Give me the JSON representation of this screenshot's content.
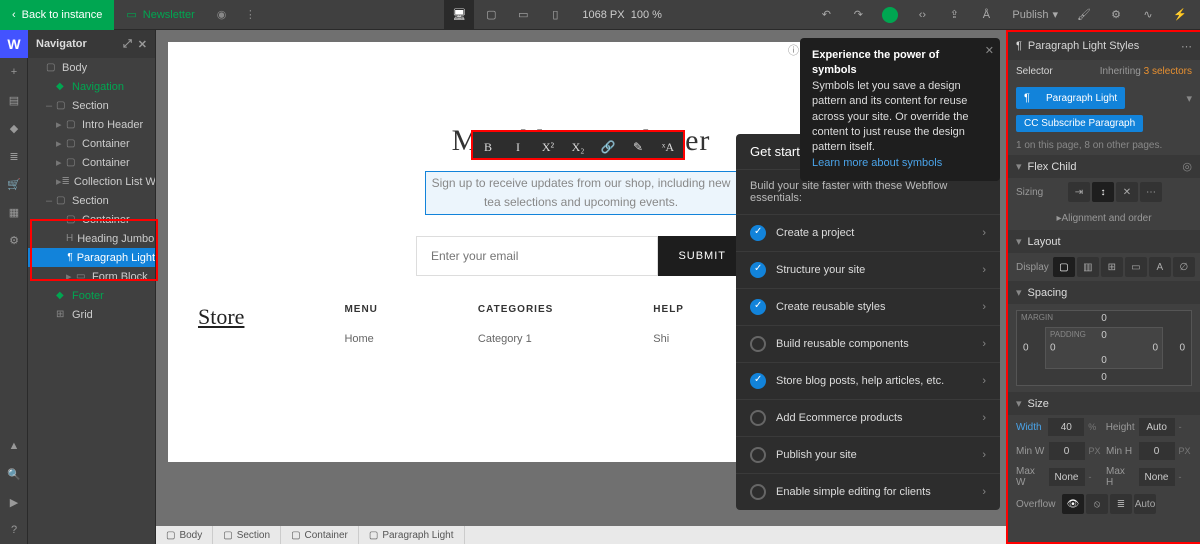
{
  "topbar": {
    "back": "Back to instance",
    "newsletter": "Newsletter",
    "px": "1068",
    "pxUnit": "PX",
    "zoom": "100 %",
    "publish": "Publish"
  },
  "navigator": {
    "title": "Navigator",
    "items": [
      {
        "label": "Body",
        "cls": "ni-0",
        "ic": "▢"
      },
      {
        "label": "Navigation",
        "cls": "ni-1 green",
        "ic": "◆"
      },
      {
        "label": "Section",
        "cls": "ni-1",
        "ic": "▢",
        "caret": "–"
      },
      {
        "label": "Intro Header",
        "cls": "ni-2",
        "ic": "▢",
        "caret": "▸"
      },
      {
        "label": "Container",
        "cls": "ni-2",
        "ic": "▢",
        "caret": "▸"
      },
      {
        "label": "Container",
        "cls": "ni-2",
        "ic": "▢",
        "caret": "▸"
      },
      {
        "label": "Collection List Wrapper",
        "cls": "ni-2",
        "ic": "≣",
        "caret": "▸"
      },
      {
        "label": "Section",
        "cls": "ni-1",
        "ic": "▢",
        "caret": "–"
      },
      {
        "label": "Container",
        "cls": "ni-2",
        "ic": "▢",
        "caret": "–"
      },
      {
        "label": "Heading Jumbo Sma",
        "cls": "ni-3",
        "ic": "H"
      },
      {
        "label": "Paragraph Light",
        "cls": "ni-3 selected",
        "ic": "¶"
      },
      {
        "label": "Form Block",
        "cls": "ni-3",
        "ic": "▭",
        "caret": "▸"
      },
      {
        "label": "Footer",
        "cls": "ni-1 green",
        "ic": "◆"
      },
      {
        "label": "Grid",
        "cls": "ni-1",
        "ic": "⊞"
      }
    ]
  },
  "canvas": {
    "headline": "Monthly Newsletter",
    "paragraph": "Sign up to receive updates from our shop, including new tea selections and upcoming events.",
    "emailPlaceholder": "Enter your email",
    "submit": "SUBMIT",
    "footer": {
      "store": "Store",
      "menu": "MENU",
      "menuItem": "Home",
      "categories": "CATEGORIES",
      "catItem": "Category 1",
      "help": "HELP",
      "helpItem": "Shi"
    }
  },
  "format": [
    "B",
    "I",
    "X²",
    "X₂",
    "🔗",
    "✎",
    "ˣA"
  ],
  "breadcrumb": [
    "Body",
    "Section",
    "Container",
    "Paragraph Light"
  ],
  "tooltip": {
    "title": "Experience the power of symbols",
    "body": "Symbols let you save a design pattern and its content for reuse across your site. Or override the content to just reuse the design pattern itself.",
    "link": "Learn more about symbols"
  },
  "getstarted": {
    "title": "Get started",
    "sub": "Build your site faster with these Webflow essentials:",
    "items": [
      {
        "t": "Create a project",
        "done": true
      },
      {
        "t": "Structure your site",
        "done": true
      },
      {
        "t": "Create reusable styles",
        "done": true
      },
      {
        "t": "Build reusable components",
        "done": false
      },
      {
        "t": "Store blog posts, help articles, etc.",
        "done": true
      },
      {
        "t": "Add Ecommerce products",
        "done": false
      },
      {
        "t": "Publish your site",
        "done": false
      },
      {
        "t": "Enable simple editing for clients",
        "done": false
      }
    ]
  },
  "styles": {
    "title": "Paragraph Light Styles",
    "selector": "Selector",
    "inheriting": "Inheriting",
    "inheritN": "3 selectors",
    "classPrimary": "Paragraph Light",
    "classSub": "CC Subscribe Paragraph",
    "pageInfo": "1 on this page, 8 on other pages.",
    "flexChild": "Flex Child",
    "sizing": "Sizing",
    "alignOrder": "Alignment and order",
    "layout": "Layout",
    "display": "Display",
    "spacing": "Spacing",
    "margin": "MARGIN",
    "padding": "PADDING",
    "vals": {
      "t": "0",
      "r": "0",
      "b": "0",
      "l": "0",
      "pt": "0",
      "pr": "0",
      "pb": "0",
      "pl": "0"
    },
    "size": "Size",
    "width": "Width",
    "widthV": "40",
    "widthU": "%",
    "height": "Height",
    "heightV": "Auto",
    "minW": "Min W",
    "minWV": "0",
    "minWU": "PX",
    "minH": "Min H",
    "minHV": "0",
    "minHU": "PX",
    "maxW": "Max W",
    "maxWV": "None",
    "maxH": "Max H",
    "maxHV": "None",
    "overflow": "Overflow",
    "overflowAuto": "Auto"
  }
}
